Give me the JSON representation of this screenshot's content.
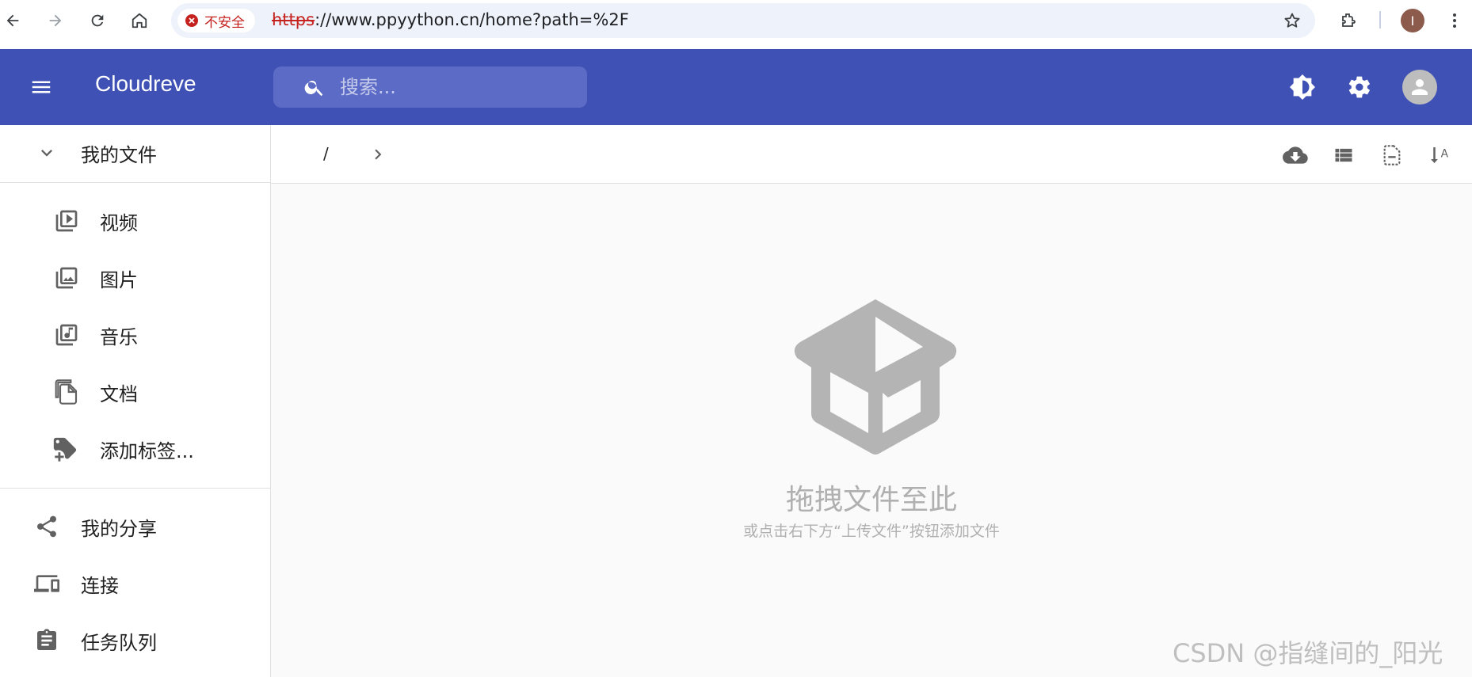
{
  "browser": {
    "security_label": "不安全",
    "url_scheme": "https",
    "url_rest": "://www.ppyython.cn/home?path=%2F",
    "profile_initial": "I"
  },
  "appbar": {
    "title": "Cloudreve",
    "search_placeholder": "搜索..."
  },
  "sidebar": {
    "my_files": "我的文件",
    "items": [
      {
        "label": "视频",
        "icon": "video-library-icon"
      },
      {
        "label": "图片",
        "icon": "photo-library-icon"
      },
      {
        "label": "音乐",
        "icon": "music-library-icon"
      },
      {
        "label": "文档",
        "icon": "file-copy-icon"
      },
      {
        "label": "添加标签...",
        "icon": "add-tag-icon"
      }
    ],
    "bottom_items": [
      {
        "label": "我的分享",
        "icon": "share-icon"
      },
      {
        "label": "连接",
        "icon": "devices-icon"
      },
      {
        "label": "任务队列",
        "icon": "clipboard-icon"
      }
    ]
  },
  "main": {
    "breadcrumb_root": "/",
    "empty_title": "拖拽文件至此",
    "empty_subtitle": "或点击右下方“上传文件”按钮添加文件"
  },
  "watermark": "CSDN @指缝间的_阳光",
  "colors": {
    "primary": "#3f51b5",
    "search_bg": "#5c6bc6",
    "insecure_red": "#c5221f",
    "empty_gray": "#b0b0b0"
  }
}
